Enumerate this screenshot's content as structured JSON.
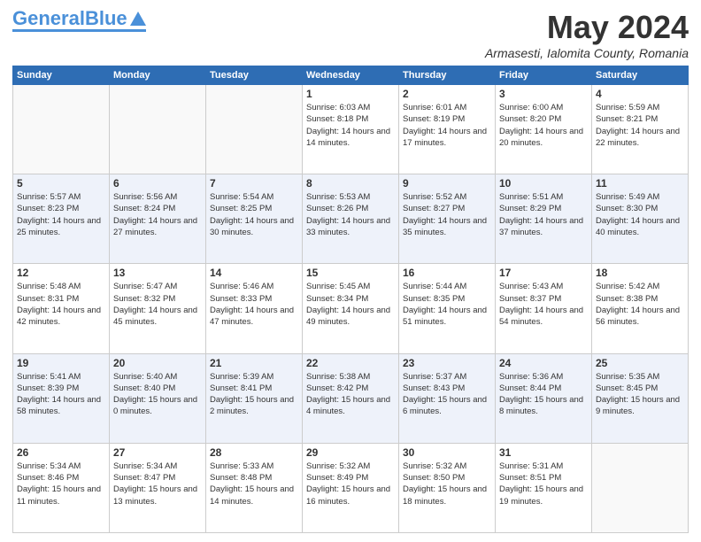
{
  "header": {
    "logo_general": "General",
    "logo_blue": "Blue",
    "month_title": "May 2024",
    "location": "Armasesti, Ialomita County, Romania"
  },
  "weekdays": [
    "Sunday",
    "Monday",
    "Tuesday",
    "Wednesday",
    "Thursday",
    "Friday",
    "Saturday"
  ],
  "weeks": [
    [
      {
        "day": "",
        "empty": true
      },
      {
        "day": "",
        "empty": true
      },
      {
        "day": "",
        "empty": true
      },
      {
        "day": "1",
        "sunrise": "6:03 AM",
        "sunset": "8:18 PM",
        "daylight": "14 hours and 14 minutes."
      },
      {
        "day": "2",
        "sunrise": "6:01 AM",
        "sunset": "8:19 PM",
        "daylight": "14 hours and 17 minutes."
      },
      {
        "day": "3",
        "sunrise": "6:00 AM",
        "sunset": "8:20 PM",
        "daylight": "14 hours and 20 minutes."
      },
      {
        "day": "4",
        "sunrise": "5:59 AM",
        "sunset": "8:21 PM",
        "daylight": "14 hours and 22 minutes."
      }
    ],
    [
      {
        "day": "5",
        "sunrise": "5:57 AM",
        "sunset": "8:23 PM",
        "daylight": "14 hours and 25 minutes."
      },
      {
        "day": "6",
        "sunrise": "5:56 AM",
        "sunset": "8:24 PM",
        "daylight": "14 hours and 27 minutes."
      },
      {
        "day": "7",
        "sunrise": "5:54 AM",
        "sunset": "8:25 PM",
        "daylight": "14 hours and 30 minutes."
      },
      {
        "day": "8",
        "sunrise": "5:53 AM",
        "sunset": "8:26 PM",
        "daylight": "14 hours and 33 minutes."
      },
      {
        "day": "9",
        "sunrise": "5:52 AM",
        "sunset": "8:27 PM",
        "daylight": "14 hours and 35 minutes."
      },
      {
        "day": "10",
        "sunrise": "5:51 AM",
        "sunset": "8:29 PM",
        "daylight": "14 hours and 37 minutes."
      },
      {
        "day": "11",
        "sunrise": "5:49 AM",
        "sunset": "8:30 PM",
        "daylight": "14 hours and 40 minutes."
      }
    ],
    [
      {
        "day": "12",
        "sunrise": "5:48 AM",
        "sunset": "8:31 PM",
        "daylight": "14 hours and 42 minutes."
      },
      {
        "day": "13",
        "sunrise": "5:47 AM",
        "sunset": "8:32 PM",
        "daylight": "14 hours and 45 minutes."
      },
      {
        "day": "14",
        "sunrise": "5:46 AM",
        "sunset": "8:33 PM",
        "daylight": "14 hours and 47 minutes."
      },
      {
        "day": "15",
        "sunrise": "5:45 AM",
        "sunset": "8:34 PM",
        "daylight": "14 hours and 49 minutes."
      },
      {
        "day": "16",
        "sunrise": "5:44 AM",
        "sunset": "8:35 PM",
        "daylight": "14 hours and 51 minutes."
      },
      {
        "day": "17",
        "sunrise": "5:43 AM",
        "sunset": "8:37 PM",
        "daylight": "14 hours and 54 minutes."
      },
      {
        "day": "18",
        "sunrise": "5:42 AM",
        "sunset": "8:38 PM",
        "daylight": "14 hours and 56 minutes."
      }
    ],
    [
      {
        "day": "19",
        "sunrise": "5:41 AM",
        "sunset": "8:39 PM",
        "daylight": "14 hours and 58 minutes."
      },
      {
        "day": "20",
        "sunrise": "5:40 AM",
        "sunset": "8:40 PM",
        "daylight": "15 hours and 0 minutes."
      },
      {
        "day": "21",
        "sunrise": "5:39 AM",
        "sunset": "8:41 PM",
        "daylight": "15 hours and 2 minutes."
      },
      {
        "day": "22",
        "sunrise": "5:38 AM",
        "sunset": "8:42 PM",
        "daylight": "15 hours and 4 minutes."
      },
      {
        "day": "23",
        "sunrise": "5:37 AM",
        "sunset": "8:43 PM",
        "daylight": "15 hours and 6 minutes."
      },
      {
        "day": "24",
        "sunrise": "5:36 AM",
        "sunset": "8:44 PM",
        "daylight": "15 hours and 8 minutes."
      },
      {
        "day": "25",
        "sunrise": "5:35 AM",
        "sunset": "8:45 PM",
        "daylight": "15 hours and 9 minutes."
      }
    ],
    [
      {
        "day": "26",
        "sunrise": "5:34 AM",
        "sunset": "8:46 PM",
        "daylight": "15 hours and 11 minutes."
      },
      {
        "day": "27",
        "sunrise": "5:34 AM",
        "sunset": "8:47 PM",
        "daylight": "15 hours and 13 minutes."
      },
      {
        "day": "28",
        "sunrise": "5:33 AM",
        "sunset": "8:48 PM",
        "daylight": "15 hours and 14 minutes."
      },
      {
        "day": "29",
        "sunrise": "5:32 AM",
        "sunset": "8:49 PM",
        "daylight": "15 hours and 16 minutes."
      },
      {
        "day": "30",
        "sunrise": "5:32 AM",
        "sunset": "8:50 PM",
        "daylight": "15 hours and 18 minutes."
      },
      {
        "day": "31",
        "sunrise": "5:31 AM",
        "sunset": "8:51 PM",
        "daylight": "15 hours and 19 minutes."
      },
      {
        "day": "",
        "empty": true
      }
    ]
  ]
}
